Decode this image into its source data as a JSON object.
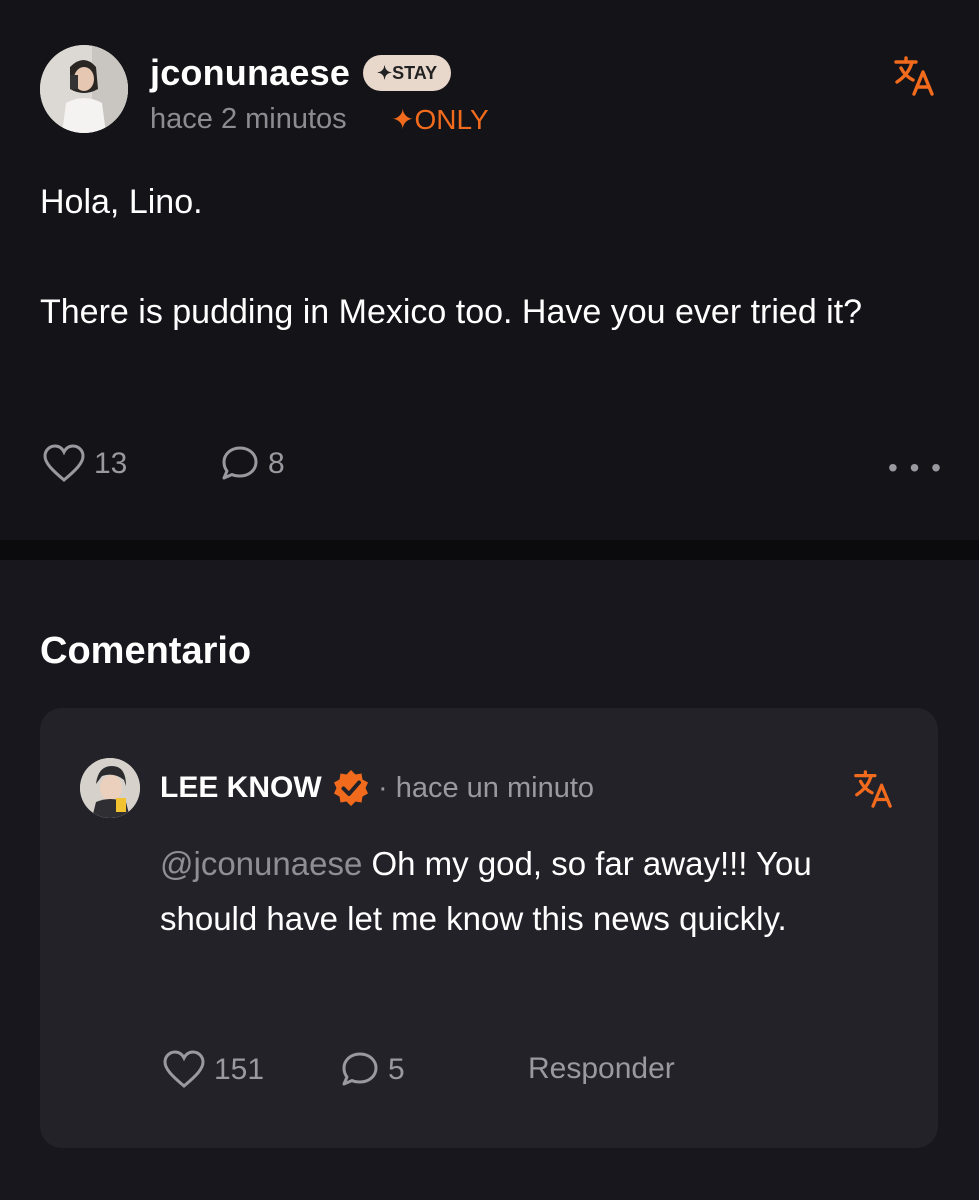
{
  "post": {
    "username": "jconunaese",
    "badge": "✦STAY",
    "time": "hace 2 minutos",
    "only_label": "✦ONLY",
    "text": "Hola, Lino.\n\nThere is pudding in Mexico too. Have you ever tried it?",
    "likes": "13",
    "comments": "8",
    "more_icon": "• • •",
    "accent_color": "#f26b1d"
  },
  "comments": {
    "title": "Comentario",
    "items": [
      {
        "name": "LEE KNOW",
        "time": "· hace un minuto",
        "mention": "@jconunaese",
        "text": " Oh my god, so far away!!! You should have let me know this news quickly.",
        "likes": "151",
        "replies": "5",
        "reply_label": "Responder"
      }
    ]
  }
}
